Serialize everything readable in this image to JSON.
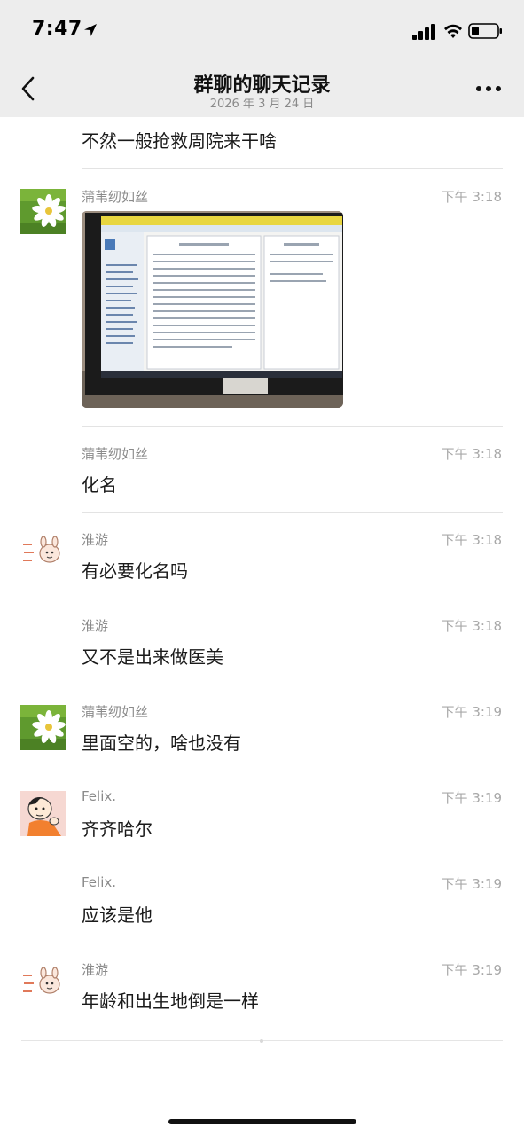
{
  "status_bar": {
    "time": "7:47"
  },
  "nav": {
    "title": "群聊的聊天记录",
    "subtitle": "2026 年 3 月 24 日"
  },
  "colors": {
    "nav_bg": "#ededed",
    "divider": "#e3e3e3",
    "name_text": "#8a8a8a",
    "time_text": "#a8a8a8"
  },
  "messages": [
    {
      "text": "不然一般抢救周院来干啥"
    },
    {
      "name": "蒲苇纫如丝",
      "time": "下午 3:18",
      "type": "image",
      "avatar": "daisy-avatar"
    },
    {
      "name": "蒲苇纫如丝",
      "time": "下午 3:18",
      "text": "化名"
    },
    {
      "name": "淮游",
      "time": "下午 3:18",
      "text": "有必要化名吗",
      "avatar": "cartoon-sketch-avatar"
    },
    {
      "name": "淮游",
      "time": "下午 3:18",
      "text": "又不是出来做医美"
    },
    {
      "name": "蒲苇纫如丝",
      "time": "下午 3:19",
      "text": "里面空的，啥也没有",
      "avatar": "daisy-avatar"
    },
    {
      "name": "Felix.",
      "time": "下午 3:19",
      "text": "齐齐哈尔",
      "avatar": "cartoon-boy-avatar"
    },
    {
      "name": "Felix.",
      "time": "下午 3:19",
      "text": "应该是他"
    },
    {
      "name": "淮游",
      "time": "下午 3:19",
      "text": "年龄和出生地倒是一样",
      "avatar": "cartoon-sketch-avatar"
    }
  ]
}
